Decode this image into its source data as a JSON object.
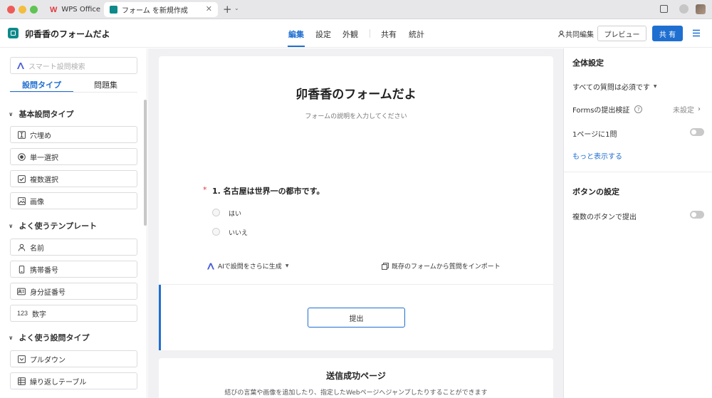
{
  "browser": {
    "tabs": [
      {
        "label": "WPS Office"
      },
      {
        "label": "フォーム を新規作成"
      }
    ]
  },
  "header": {
    "title": "卯香香のフォームだよ",
    "nav": [
      {
        "label": "編集"
      },
      {
        "label": "設定"
      },
      {
        "label": "外観"
      },
      {
        "label": "共有"
      },
      {
        "label": "統計"
      }
    ],
    "coedit_label": "共同編集",
    "preview_label": "プレビュー",
    "share_label": "共 有"
  },
  "sidebar": {
    "search_placeholder": "スマート設問検索",
    "tabs": [
      {
        "label": "設問タイプ"
      },
      {
        "label": "問題集"
      }
    ],
    "sections": [
      {
        "title": "基本設問タイプ",
        "items": [
          {
            "label": "穴埋め",
            "icon": "text-fill-icon"
          },
          {
            "label": "単一選択",
            "icon": "radio-icon"
          },
          {
            "label": "複数選択",
            "icon": "checkbox-icon"
          },
          {
            "label": "画像",
            "icon": "image-icon"
          }
        ]
      },
      {
        "title": "よく使うテンプレート",
        "items": [
          {
            "label": "名前",
            "icon": "person-icon"
          },
          {
            "label": "携帯番号",
            "icon": "phone-icon"
          },
          {
            "label": "身分証番号",
            "icon": "id-card-icon"
          },
          {
            "label": "数字",
            "icon": "number-icon",
            "glyph": "123"
          }
        ]
      },
      {
        "title": "よく使う設問タイプ",
        "items": [
          {
            "label": "プルダウン",
            "icon": "dropdown-icon"
          },
          {
            "label": "繰り返しテーブル",
            "icon": "table-icon"
          }
        ]
      }
    ]
  },
  "form": {
    "title": "卯香香のフォームだよ",
    "description_placeholder": "フォームの説明を入力してください",
    "question": {
      "required_mark": "*",
      "text": "1. 名古屋は世界一の都市です。",
      "options": [
        "はい",
        "いいえ"
      ]
    },
    "ai_generate_label": "AIで設問をさらに生成",
    "import_label": "既存のフォームから質問をインポート",
    "submit_label": "提出",
    "success": {
      "title": "送信成功ページ",
      "desc": "結びの言葉や画像を追加したり、指定したWebページへジャンプしたりすることができます"
    }
  },
  "right_panel": {
    "general_title": "全体設定",
    "all_required_label": "すべての質問は必須です",
    "forms_validation_label": "Formsの提出検証",
    "forms_validation_value": "未設定",
    "one_per_page_label": "1ページに1問",
    "one_per_page_on": false,
    "show_more_label": "もっと表示する",
    "buttons_title": "ボタンの設定",
    "multi_submit_label": "複数のボタンで提出",
    "multi_submit_on": false
  },
  "colors": {
    "accent": "#1f6fd1",
    "wps_red": "#e0393e",
    "brand_teal": "#0f8a8a",
    "canvas_bg": "#f1f1f3"
  }
}
